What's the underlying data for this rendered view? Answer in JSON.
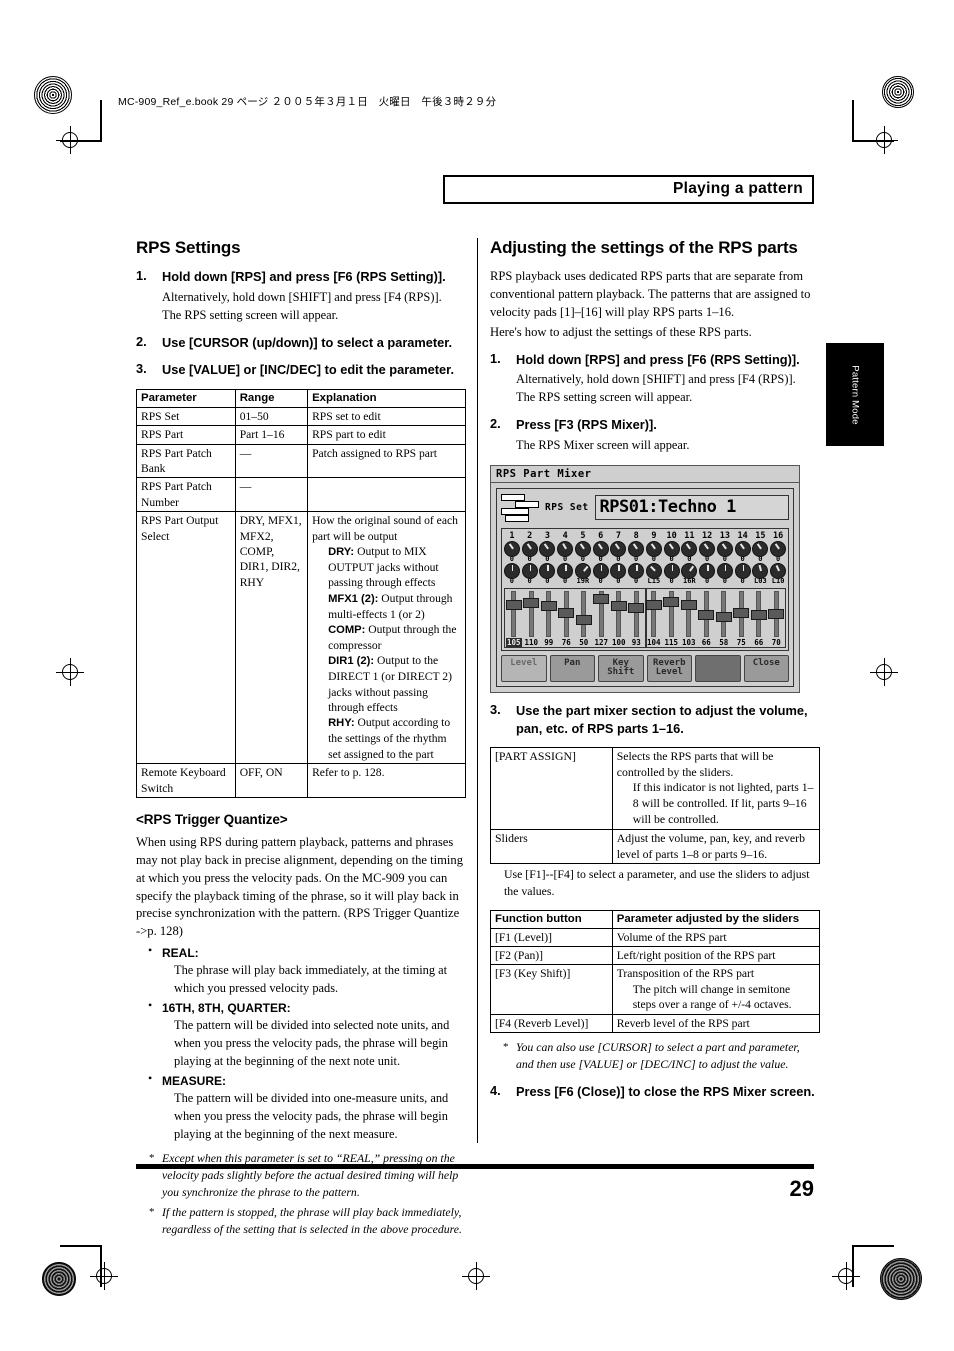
{
  "page": {
    "file_header": "MC-909_Ref_e.book  29 ページ  ２００５年３月１日　火曜日　午後３時２９分",
    "running_head": "Playing a pattern",
    "thumb_tab": "Pattern Mode",
    "page_number": "29"
  },
  "left": {
    "heading": "RPS Settings",
    "steps": [
      {
        "num": "1.",
        "text": "Hold down [RPS] and press [F6 (RPS Setting)].",
        "subs": [
          "Alternatively, hold down [SHIFT] and press [F4 (RPS)].",
          "The RPS setting screen will appear."
        ]
      },
      {
        "num": "2.",
        "text": "Use [CURSOR (up/down)] to select a parameter.",
        "subs": []
      },
      {
        "num": "3.",
        "text": "Use [VALUE] or [INC/DEC] to edit the parameter.",
        "subs": []
      }
    ],
    "param_table": {
      "headers": [
        "Parameter",
        "Range",
        "Explanation"
      ],
      "rows": [
        {
          "parameter": "RPS Set",
          "range": "01–50",
          "explanation": "RPS set to edit"
        },
        {
          "parameter": "RPS Part",
          "range": "Part 1–16",
          "explanation": "RPS part to edit"
        },
        {
          "parameter": "RPS Part Patch Bank",
          "range": "—",
          "explanation": "Patch assigned to RPS part"
        },
        {
          "parameter": "RPS Part Patch Number",
          "range": "—",
          "explanation": ""
        },
        {
          "parameter": "RPS Part Output Select",
          "range": "DRY, MFX1, MFX2, COMP, DIR1, DIR2, RHY",
          "explanation": "How the original sound of each part will be output",
          "details": [
            {
              "label": "DRY:",
              "text": "Output to MIX OUTPUT jacks without passing through effects"
            },
            {
              "label": "MFX1 (2):",
              "text": "Output through multi-effects 1 (or 2)"
            },
            {
              "label": "COMP:",
              "text": "Output through the compressor"
            },
            {
              "label": "DIR1 (2):",
              "text": "Output to the DIRECT 1 (or DIRECT 2) jacks without passing through effects"
            },
            {
              "label": "RHY:",
              "text": "Output according to the settings of the rhythm set assigned to the part"
            }
          ]
        },
        {
          "parameter": "Remote Keyboard Switch",
          "range": "OFF, ON",
          "explanation": "Refer to p. 128."
        }
      ]
    },
    "quantize": {
      "heading": "<RPS Trigger Quantize>",
      "intro": "When using RPS during pattern playback, patterns and phrases may not play back in precise alignment, depending on the timing at which you press the velocity pads. On the MC-909 you can specify the playback timing of the phrase, so it will play back in precise synchronization with the pattern. (RPS Trigger Quantize ->p. 128)",
      "items": [
        {
          "label": "REAL:",
          "body": "The phrase will play back immediately, at the timing at which you pressed velocity pads."
        },
        {
          "label": "16TH, 8TH, QUARTER:",
          "body": "The pattern will be divided into selected note units, and when you press the velocity pads, the phrase will begin playing at the beginning of the next note unit."
        },
        {
          "label": "MEASURE:",
          "body": "The pattern will be divided into one-measure units, and when you press the velocity pads, the phrase will begin playing at the beginning of the next measure."
        }
      ],
      "notes": [
        "Except when this parameter is set to “REAL,” pressing on the velocity pads slightly before the actual desired timing will help you synchronize the phrase to the pattern.",
        "If the pattern is stopped, the phrase will play back immediately, regardless of the setting that is selected in the above procedure."
      ]
    }
  },
  "right": {
    "heading": "Adjusting the settings of the RPS parts",
    "intro1": "RPS playback uses dedicated RPS parts that are separate from conventional pattern playback. The patterns that are assigned to velocity pads [1]–[16] will play RPS parts 1–16.",
    "intro2": "Here's how to adjust the settings of these RPS parts.",
    "steps12": [
      {
        "num": "1.",
        "text": "Hold down [RPS] and press [F6 (RPS Setting)].",
        "subs": [
          "Alternatively, hold down [SHIFT] and press [F4 (RPS)].",
          "The RPS setting screen will appear."
        ]
      },
      {
        "num": "2.",
        "text": "Press [F3 (RPS Mixer)].",
        "subs": [
          "The RPS Mixer screen will appear."
        ]
      }
    ],
    "step3": {
      "num": "3.",
      "text": "Use the part mixer section to adjust the volume, pan, etc. of RPS parts 1–16."
    },
    "assign_table": {
      "rows": [
        {
          "label": "[PART ASSIGN]",
          "text": "Selects the RPS parts that will be controlled by the sliders.",
          "indent": "If this indicator is not lighted, parts 1–8 will be controlled. If lit, parts 9–16 will be controlled."
        },
        {
          "label": "Sliders",
          "text": "Adjust the volume, pan, key, and reverb level of parts 1–8 or parts 9–16.",
          "indent": ""
        }
      ]
    },
    "after_assign": "Use [F1]--[F4] to select a parameter, and use the sliders to adjust the values.",
    "function_table": {
      "headers": [
        "Function button",
        "Parameter adjusted by the sliders"
      ],
      "rows": [
        {
          "button": "[F1 (Level)]",
          "param": "Volume of the RPS part",
          "indent": ""
        },
        {
          "button": "[F2 (Pan)]",
          "param": "Left/right position of the RPS part",
          "indent": ""
        },
        {
          "button": "[F3 (Key Shift)]",
          "param": "Transposition of the RPS part",
          "indent": "The pitch will change in semitone steps over a range of +/-4 octaves."
        },
        {
          "button": "[F4 (Reverb Level)]",
          "param": "Reverb level of the RPS part",
          "indent": ""
        }
      ]
    },
    "function_note": "You can also use [CURSOR] to select a part and parameter, and then use [VALUE] or [DEC/INC] to adjust the value.",
    "step4": {
      "num": "4.",
      "text": "Press [F6 (Close)] to close the RPS Mixer screen."
    }
  },
  "lcd": {
    "window_title": "RPS Part Mixer",
    "rps_set_label": "RPS Set",
    "rps_set_value": "RPS01:Techno 1",
    "part_numbers": [
      "1",
      "2",
      "3",
      "4",
      "5",
      "6",
      "7",
      "8",
      "9",
      "10",
      "11",
      "12",
      "13",
      "14",
      "15",
      "16"
    ],
    "knob_row1_values": [
      "0",
      "0",
      "0",
      "0",
      "0",
      "0",
      "0",
      "0",
      "0",
      "0",
      "0",
      "0",
      "0",
      "0",
      "0",
      "0"
    ],
    "knob_row1_angles": [
      -35,
      -35,
      -35,
      -30,
      -35,
      -35,
      -35,
      -35,
      -35,
      -35,
      -35,
      -35,
      -35,
      -35,
      -35,
      -35
    ],
    "knob_row2_values": [
      "0",
      "0",
      "0",
      "0",
      "19R",
      "0",
      "0",
      "0",
      "L15",
      "0",
      "16R",
      "0",
      "0",
      "0",
      "L03",
      "L10"
    ],
    "knob_row2_angles": [
      0,
      0,
      0,
      0,
      40,
      0,
      0,
      0,
      -45,
      0,
      35,
      0,
      0,
      0,
      -15,
      -25
    ],
    "slider_values": [
      "105",
      "110",
      "99",
      "76",
      "50",
      "127",
      "100",
      "93",
      "104",
      "115",
      "103",
      "66",
      "58",
      "75",
      "66",
      "70"
    ],
    "slider_highlight_index": 0,
    "function_buttons": [
      {
        "label": "Level",
        "state": "active"
      },
      {
        "label": "Pan",
        "state": "normal"
      },
      {
        "label": "Key\nShift",
        "state": "normal"
      },
      {
        "label": "Reverb\nLevel",
        "state": "normal"
      },
      {
        "label": "",
        "state": "blank"
      },
      {
        "label": "Close",
        "state": "normal"
      }
    ]
  }
}
